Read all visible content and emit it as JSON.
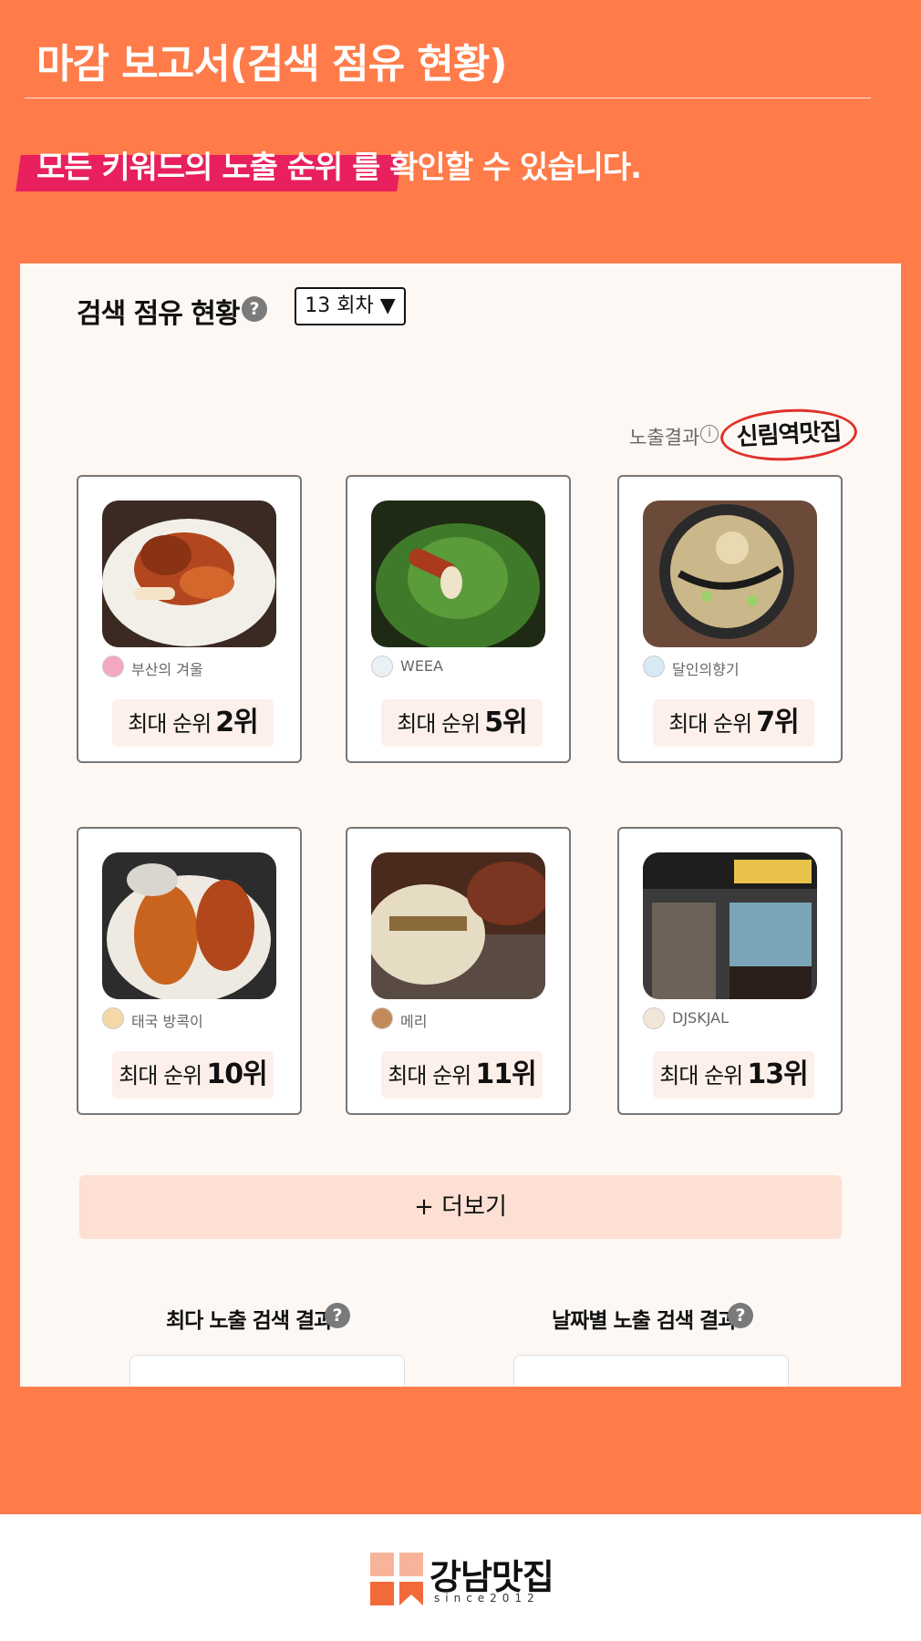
{
  "header": {
    "title": "마감 보고서(검색 점유 현황)",
    "subtitle": "모든 키워드의 노출 순위 를 확인할 수 있습니다."
  },
  "panel": {
    "section_title": "검색 점유 현황",
    "help_icon": "?",
    "round_select": "13 회차 ▼",
    "exposure_label": "노출결과",
    "info_icon": "i",
    "keyword": "신림역맛집",
    "rank_label": "최대 순위",
    "cards": [
      {
        "blogger": "부산의 겨울",
        "rank": "2위"
      },
      {
        "blogger": "WEEA",
        "rank": "5위"
      },
      {
        "blogger": "달인의향기",
        "rank": "7위"
      },
      {
        "blogger": "태국 방콕이",
        "rank": "10위"
      },
      {
        "blogger": "메리",
        "rank": "11위"
      },
      {
        "blogger": "DJSKJAL",
        "rank": "13위"
      }
    ],
    "more_button": "+ 더보기",
    "bottom_left_title": "최다 노출 검색 결과",
    "bottom_right_title": "날짜별 노출 검색 결과"
  },
  "footer": {
    "logo_text": "강남맛집",
    "logo_sub": "since2012"
  },
  "colors": {
    "background": "#ff7b49",
    "highlight": "#e8205e",
    "panel": "#fdf8f4",
    "pill": "#fdf0ea",
    "more_button": "#fde0d3",
    "keyword_circle": "#e0312a"
  },
  "icons": [
    "help-icon",
    "info-icon",
    "dropdown-arrow-icon",
    "logo-icon"
  ]
}
